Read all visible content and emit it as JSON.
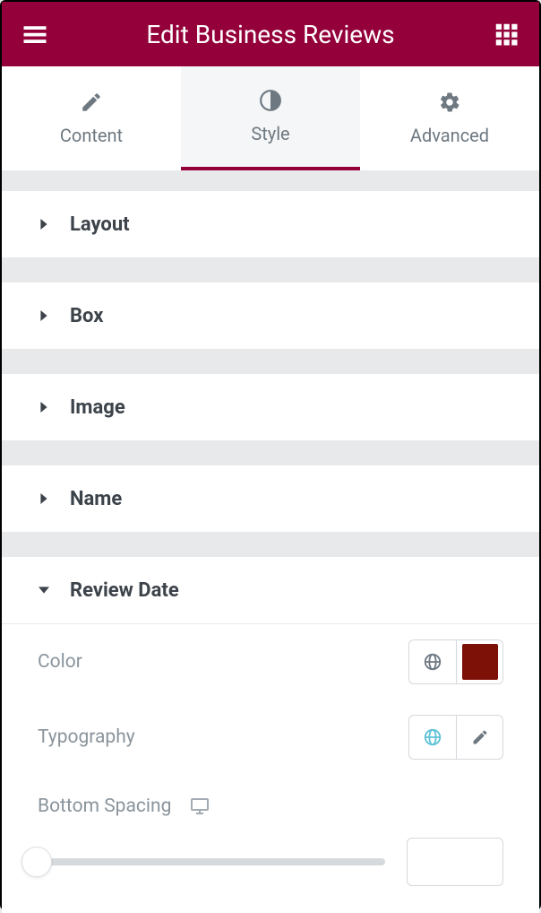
{
  "header": {
    "title": "Edit Business Reviews"
  },
  "tabs": {
    "content": "Content",
    "style": "Style",
    "advanced": "Advanced",
    "active": "style"
  },
  "sections": [
    {
      "id": "layout",
      "title": "Layout",
      "expanded": false
    },
    {
      "id": "box",
      "title": "Box",
      "expanded": false
    },
    {
      "id": "image",
      "title": "Image",
      "expanded": false
    },
    {
      "id": "name",
      "title": "Name",
      "expanded": false
    },
    {
      "id": "review-date",
      "title": "Review Date",
      "expanded": true
    }
  ],
  "review_date": {
    "color_label": "Color",
    "color_value": "#7d1107",
    "typography_label": "Typography",
    "bottom_spacing_label": "Bottom Spacing",
    "bottom_spacing_value": ""
  }
}
